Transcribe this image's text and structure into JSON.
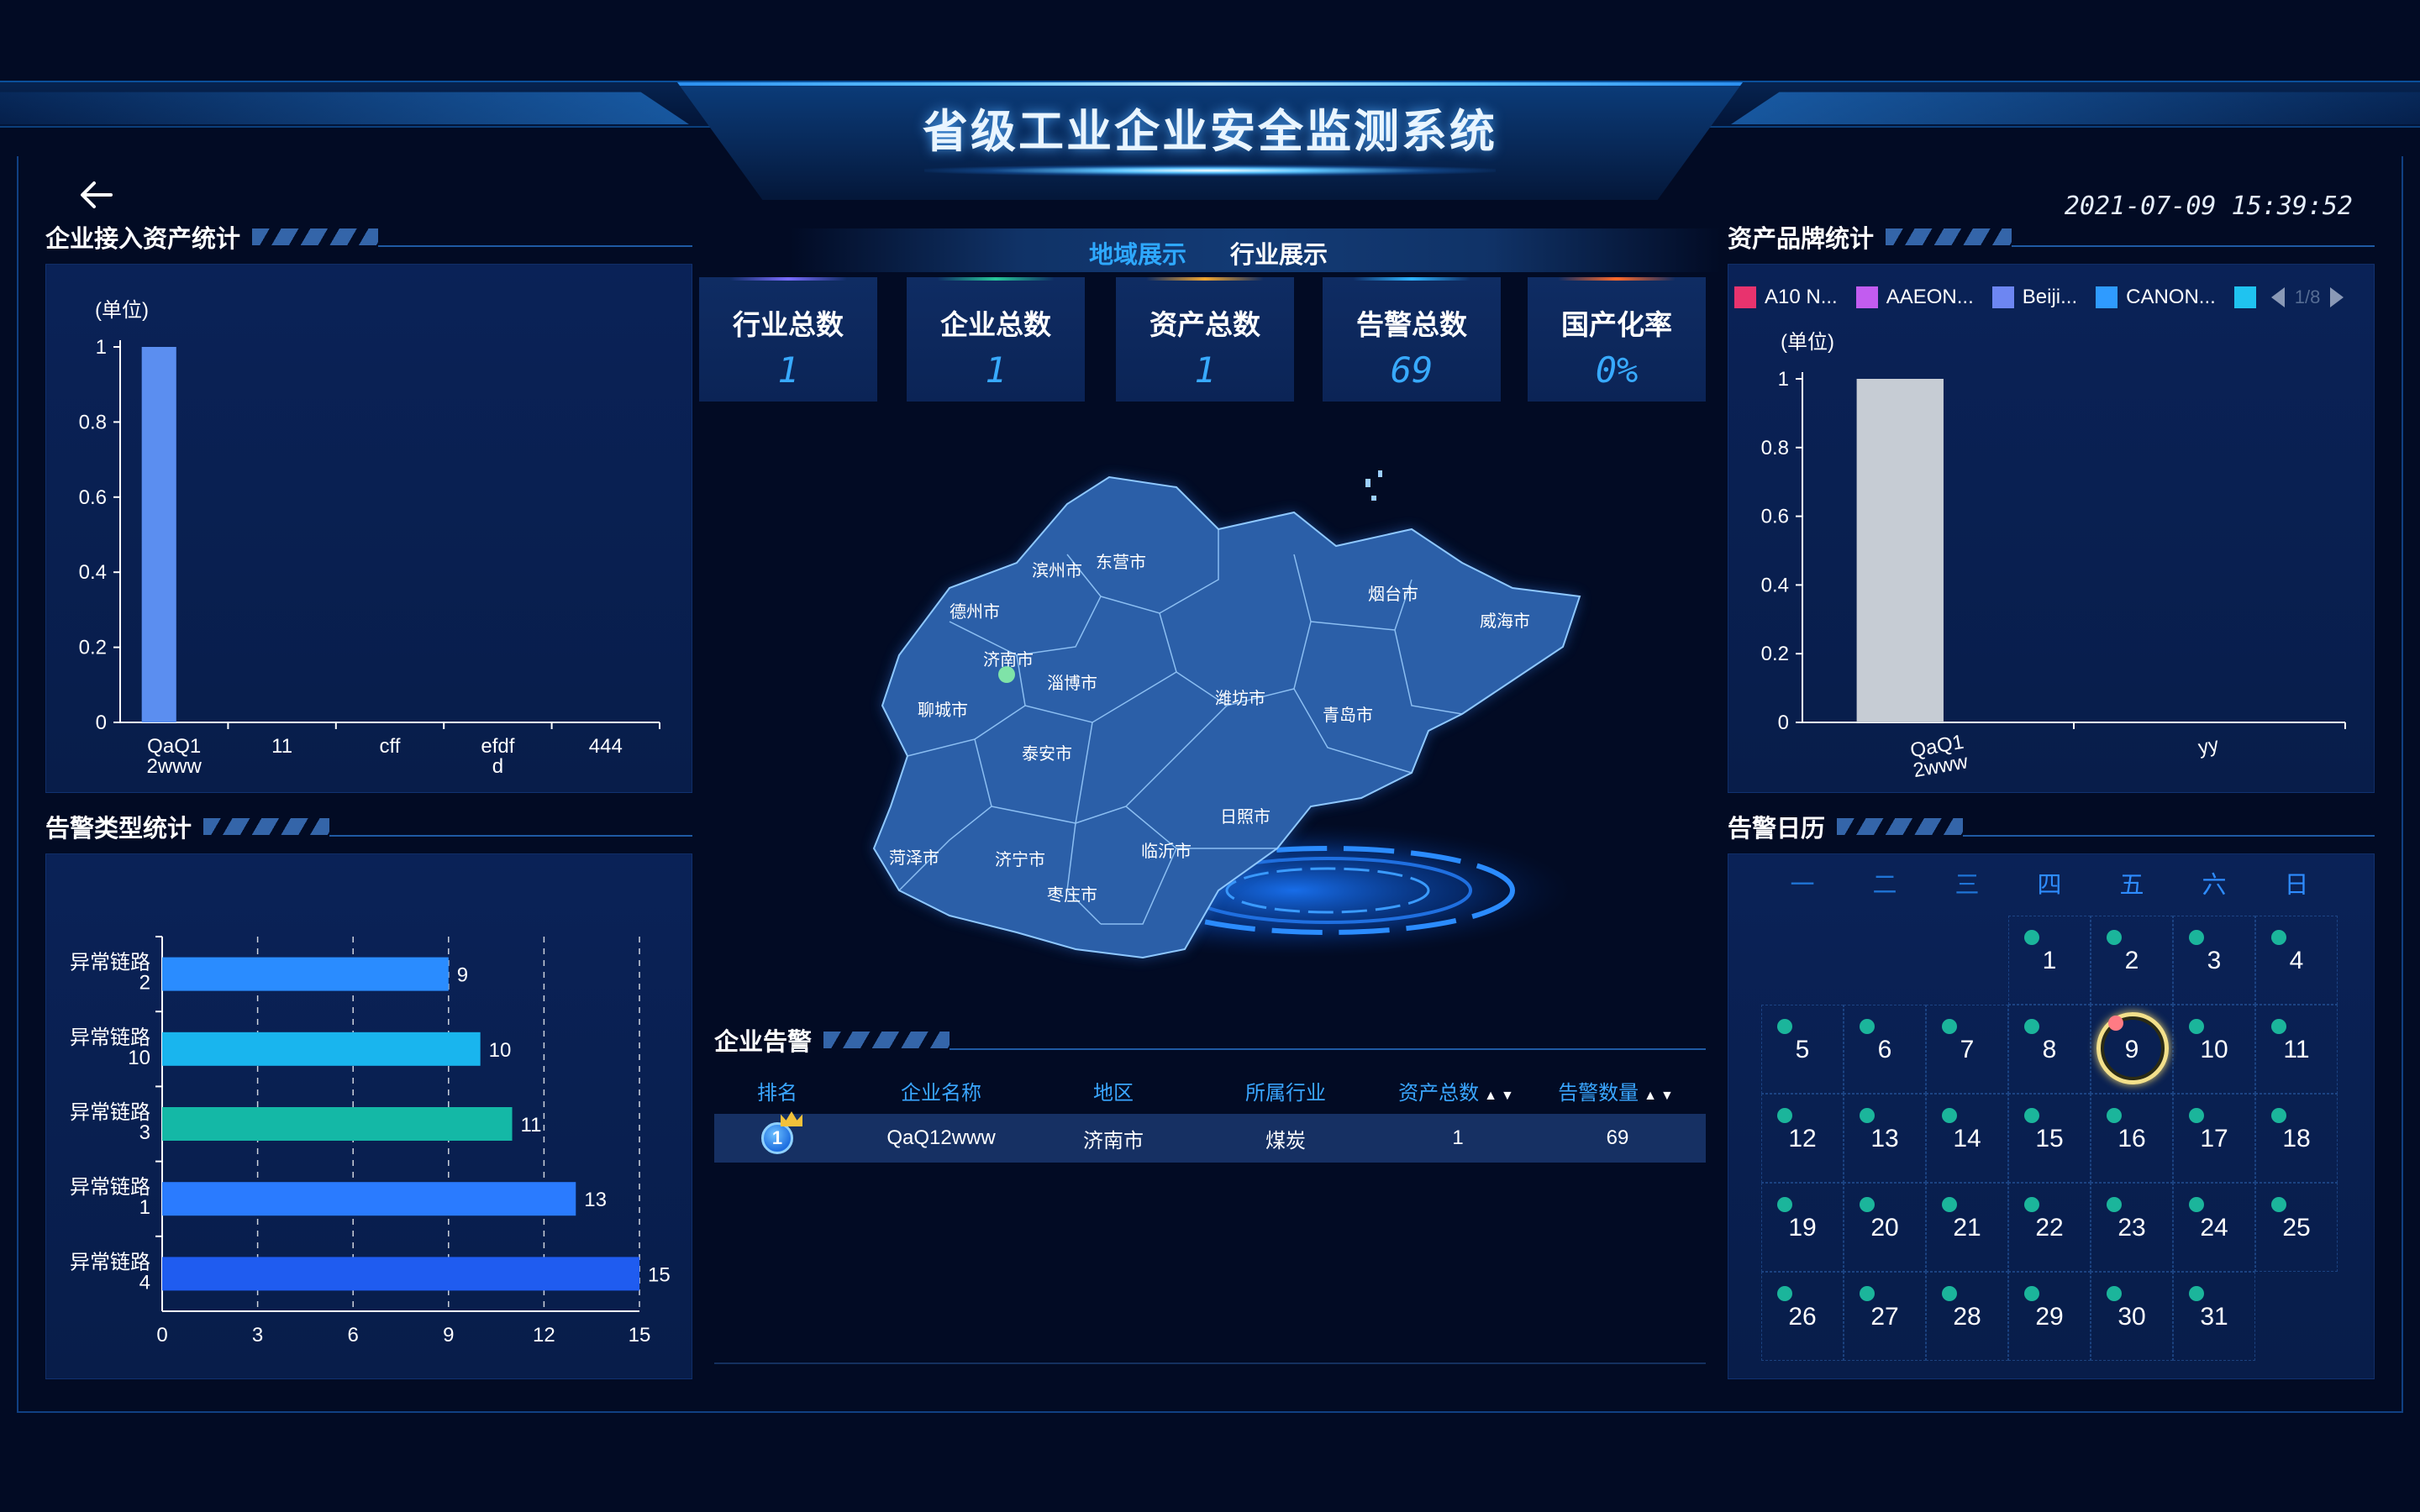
{
  "header": {
    "title": "省级工业企业安全监测系统",
    "datetime": "2021-07-09 15:39:52"
  },
  "tabs": [
    {
      "label": "地域展示",
      "active": true
    },
    {
      "label": "行业展示",
      "active": false
    }
  ],
  "stats": [
    {
      "label": "行业总数",
      "value": "1",
      "accent": "#7a6cff"
    },
    {
      "label": "企业总数",
      "value": "1",
      "accent": "#27c79a"
    },
    {
      "label": "资产总数",
      "value": "1",
      "accent": "#f0a531"
    },
    {
      "label": "告警总数",
      "value": "69",
      "accent": "#2fb4ff"
    },
    {
      "label": "国产化率",
      "value": "0%",
      "accent": "#ff6a2b"
    }
  ],
  "panels": {
    "asset_access": {
      "title": "企业接入资产统计",
      "unit": "(单位)"
    },
    "alert_type": {
      "title": "告警类型统计"
    },
    "brand": {
      "title": "资产品牌统计",
      "unit": "(单位)"
    },
    "calendar": {
      "title": "告警日历"
    },
    "enterprise_alert": {
      "title": "企业告警"
    }
  },
  "map": {
    "cities": [
      "德州市",
      "滨州市",
      "东营市",
      "烟台市",
      "威海市",
      "济南市",
      "淄博市",
      "潍坊市",
      "青岛市",
      "聊城市",
      "泰安市",
      "日照市",
      "菏泽市",
      "济宁市",
      "临沂市",
      "枣庄市"
    ]
  },
  "brand_legend": {
    "items": [
      {
        "label": "A10 N...",
        "color": "#e8336e"
      },
      {
        "label": "AAEON...",
        "color": "#c25cf0"
      },
      {
        "label": "Beiji...",
        "color": "#6d86f2"
      },
      {
        "label": "CANON...",
        "color": "#2f9bff"
      },
      {
        "label": "",
        "color": "#1fc3f0"
      }
    ],
    "page": "1/8"
  },
  "alert_table": {
    "columns": [
      "排名",
      "企业名称",
      "地区",
      "所属行业",
      "资产总数",
      "告警数量"
    ],
    "rows": [
      {
        "rank": "1",
        "name": "QaQ12www",
        "region": "济南市",
        "industry": "煤炭",
        "assets": "1",
        "alerts": "69"
      }
    ]
  },
  "calendar": {
    "weekdays": [
      "一",
      "二",
      "三",
      "四",
      "五",
      "六",
      "日"
    ],
    "first_weekday_index": 3,
    "days": 31,
    "today": 9,
    "weekday_colors": [
      "#1f74d6",
      "#1f74d6",
      "#1f74d6",
      "#2e8cff",
      "#2e8cff",
      "#2e8cff",
      "#2e8cff"
    ]
  },
  "chart_data": [
    {
      "type": "bar",
      "id": "asset_access",
      "categories": [
        "QaQ1\n2www",
        "11",
        "cff",
        "efdf\nd",
        "444"
      ],
      "values": [
        1,
        0,
        0,
        0,
        0
      ],
      "ylim": [
        0,
        1
      ],
      "yticks": [
        0,
        0.2,
        0.4,
        0.6,
        0.8,
        1
      ],
      "color": "#5b8ef0"
    },
    {
      "type": "bar",
      "id": "alert_type",
      "orientation": "horizontal",
      "categories": [
        "异常链路\n2",
        "异常链路\n10",
        "异常链路\n3",
        "异常链路\n1",
        "异常链路\n4"
      ],
      "values": [
        9,
        10,
        11,
        13,
        15
      ],
      "colors": [
        "#2a8cff",
        "#19b5ee",
        "#14b8a6",
        "#2a7bff",
        "#1f5cf0"
      ],
      "xlim": [
        0,
        15
      ],
      "xticks": [
        0,
        3,
        6,
        9,
        12,
        15
      ]
    },
    {
      "type": "bar",
      "id": "brand",
      "categories": [
        "QaQ1\n2www",
        "yy"
      ],
      "values": [
        1,
        0
      ],
      "ylim": [
        0,
        1
      ],
      "yticks": [
        0,
        0.2,
        0.4,
        0.6,
        0.8,
        1
      ],
      "color": "#c6ccd4"
    }
  ]
}
